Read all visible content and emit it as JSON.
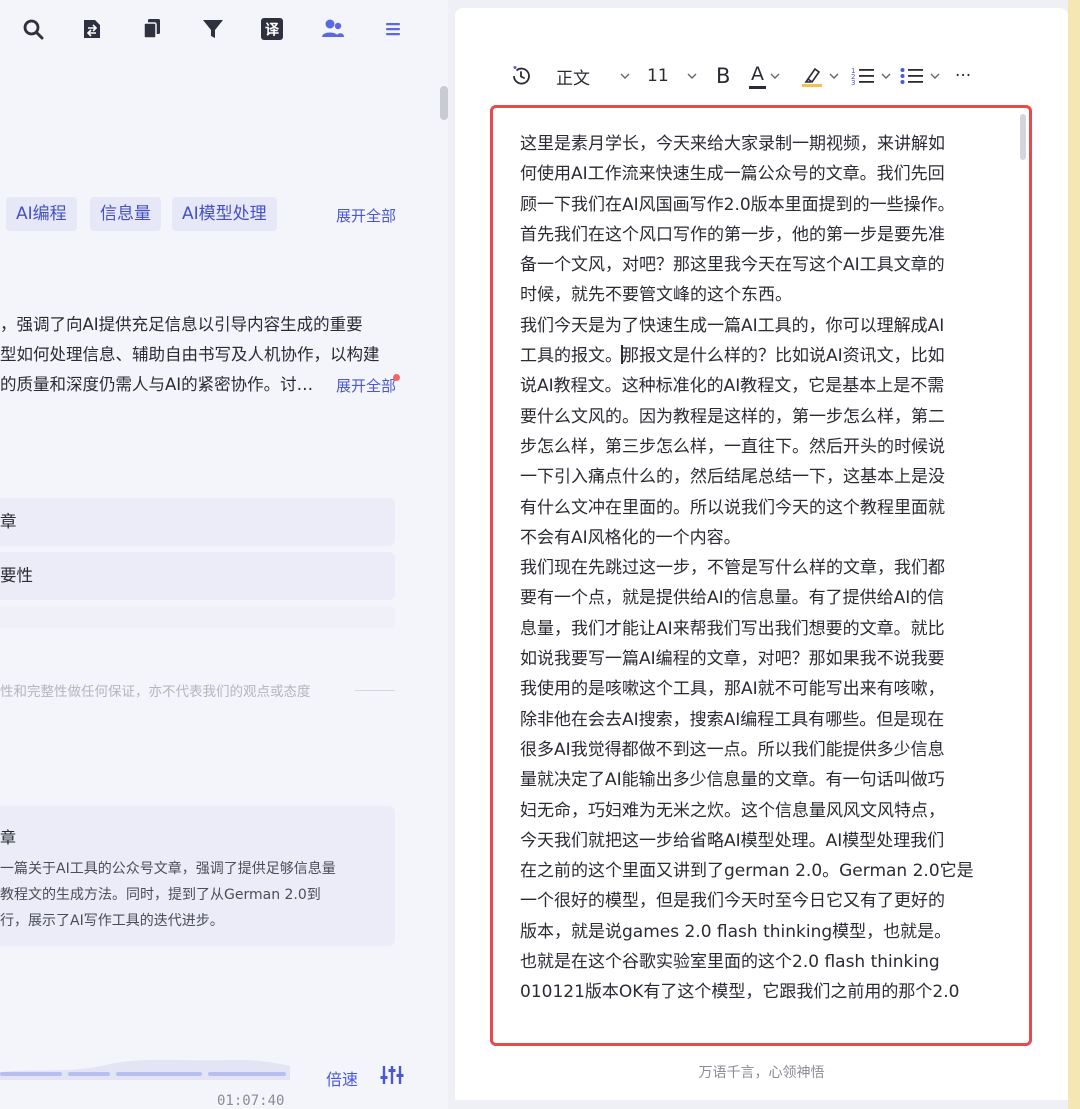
{
  "left_panel": {
    "toolbar": [
      {
        "name": "search-icon"
      },
      {
        "name": "document-export-icon"
      },
      {
        "name": "copy-icon"
      },
      {
        "name": "filter-icon"
      },
      {
        "name": "translate-icon",
        "glyph": "译"
      },
      {
        "name": "users-icon"
      },
      {
        "name": "menu-icon"
      }
    ],
    "tags": [
      "AI编程",
      "信息量",
      "AI模型处理"
    ],
    "tags_expand": "展开全部",
    "summary_lines": [
      "，强调了向AI提供充足信息以引导内容生成的重要",
      "型如何处理信息、辅助自由书写及人机协作，以构建",
      "的质量和深度仍需人与AI的紧密协作。讨…"
    ],
    "summary_expand": "展开全部",
    "outline_items": [
      "章",
      "要性"
    ],
    "disclaimer": "性和完整性做任何保证，亦不代表我们的观点或态度",
    "ai_summary": {
      "heading": "章",
      "lines": [
        "一篇关于AI工具的公众号文章，强调了提供足够信息量",
        "教程文的生成方法。同时，提到了从German 2.0到",
        "行，展示了AI写作工具的迭代进步。"
      ]
    },
    "player": {
      "speed_label": "倍速",
      "time": "01:07:40"
    }
  },
  "editor": {
    "toolbar": {
      "history_icon": "history-icon",
      "style": "正文",
      "font_size": "11",
      "bold": "B",
      "font_color_letter": "A",
      "font_color": "#2a2b33",
      "highlight_color": "#f2c24a",
      "more": "···"
    },
    "paragraphs": [
      [
        "这里是素月学长，今天来给大家录制一期视频，来讲解如",
        "何使用AI工作流来快速生成一篇公众号的文章。我们先回",
        "顾一下我们在AI风国画写作2.0版本里面提到的一些操作。",
        "首先我们在这个风口写作的第一步，他的第一步是要先准",
        "备一个文风，对吧？那这里我今天在写这个AI工具文章的",
        "时候，就先不要管文峰的这个东西。"
      ],
      [
        "我们今天是为了快速生成一篇AI工具的，你可以理解成AI",
        "工具的报文。那报文是什么样的？比如说AI资讯文，比如",
        "说AI教程文。这种标准化的AI教程文，它是基本上是不需",
        "要什么文风的。因为教程是这样的，第一步怎么样，第二",
        "步怎么样，第三步怎么样，一直往下。然后开头的时候说",
        "一下引入痛点什么的，然后结尾总结一下，这基本上是没",
        "有什么文冲在里面的。所以说我们今天的这个教程里面就",
        "不会有AI风格化的一个内容。"
      ],
      [
        "我们现在先跳过这一步，不管是写什么样的文章，我们都",
        "要有一个点，就是提供给AI的信息量。有了提供给AI的信",
        "息量，我们才能让AI来帮我们写出我们想要的文章。就比",
        "如说我要写一篇AI编程的文章，对吧？那如果我不说我要",
        "我使用的是咳嗽这个工具，那AI就不可能写出来有咳嗽，",
        "除非他在会去AI搜索，搜索AI编程工具有哪些。但是现在",
        "很多AI我觉得都做不到这一点。所以我们能提供多少信息",
        "量就决定了AI能输出多少信息量的文章。有一句话叫做巧",
        "妇无命，巧妇难为无米之炊。这个信息量风风文风特点，",
        "今天我们就把这一步给省略AI模型处理。AI模型处理我们",
        "在之前的这个里面又讲到了german 2.0。German 2.0它是",
        "一个很好的模型，但是我们今天时至今日它又有了更好的",
        "版本，就是说games 2.0 flash thinking模型，也就是。"
      ],
      [
        "也就是在这个谷歌实验室里面的这个2.0 flash thinking",
        "010121版本OK有了这个模型，它跟我们之前用的那个2.0"
      ]
    ],
    "footer_slogan": "万语千言，心领神悟"
  }
}
